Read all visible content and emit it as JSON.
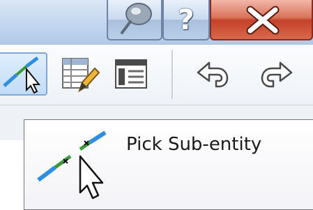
{
  "window": {
    "buttons": {
      "pin_icon": "pushpin-icon",
      "help_label": "?",
      "close_icon": "close-icon"
    }
  },
  "toolbar": {
    "items": [
      {
        "name": "pick-sub-entity-icon"
      },
      {
        "name": "table-edit-icon"
      },
      {
        "name": "properties-sheet-icon"
      },
      {
        "name": "undo-icon"
      },
      {
        "name": "redo-icon"
      }
    ]
  },
  "tooltip": {
    "label": "Pick Sub-entity",
    "icon": "pick-sub-entity-icon"
  },
  "colors": {
    "title_bar": "#c2d6ee",
    "close_button": "#c4412a",
    "accent_blue": "#2e8fe0",
    "accent_green": "#3a9a3a"
  }
}
